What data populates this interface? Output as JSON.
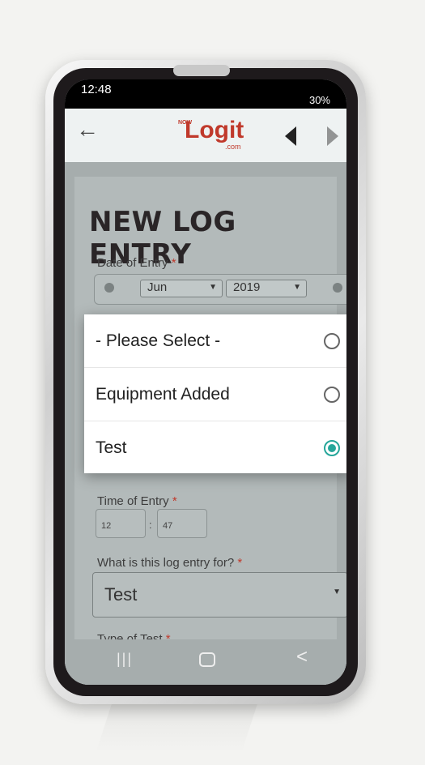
{
  "status_bar": {
    "time": "12:48",
    "signal_battery": "30%"
  },
  "app_bar": {
    "logo_prefix": "NOW",
    "logo_text": "Logit",
    "logo_suffix": ".com"
  },
  "page": {
    "title": "NEW LOG ENTRY"
  },
  "form": {
    "date_label": "Date of Entry",
    "required_mark": "*",
    "month_value": "Jun",
    "year_value": "2019",
    "time_label": "Time of Entry",
    "time_hour": "12",
    "time_separator": ":",
    "time_minute": "47",
    "purpose_label": "What is this log entry for?",
    "purpose_value": "Test",
    "type_label": "Type of Test"
  },
  "dialog": {
    "options": [
      {
        "label": "- Please Select -",
        "selected": false
      },
      {
        "label": "Equipment Added",
        "selected": false
      },
      {
        "label": "Test",
        "selected": true
      }
    ]
  },
  "nav_bar": {
    "recent_glyph": "|||",
    "back_glyph": "<"
  },
  "colors": {
    "accent": "#26a69a",
    "brand": "#c0392b"
  }
}
